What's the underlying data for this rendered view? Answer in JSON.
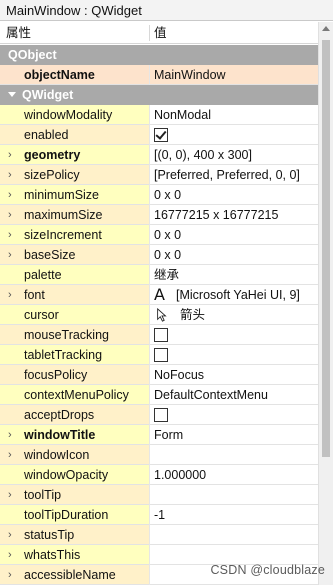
{
  "window": {
    "title": "MainWindow : QWidget"
  },
  "header": {
    "property": "属性",
    "value": "值"
  },
  "rows": [
    {
      "kind": "group",
      "name": "QObject"
    },
    {
      "kind": "prop",
      "name": "objectName",
      "value": "MainWindow",
      "bold": true
    },
    {
      "kind": "group",
      "name": "QWidget",
      "expanded": true
    },
    {
      "kind": "prop",
      "name": "windowModality",
      "value": "NonModal"
    },
    {
      "kind": "prop",
      "name": "enabled",
      "value": "checked"
    },
    {
      "kind": "prop",
      "name": "geometry",
      "value": "[(0, 0), 400 x 300]",
      "bold": true,
      "expandable": true
    },
    {
      "kind": "prop",
      "name": "sizePolicy",
      "value": "[Preferred, Preferred, 0, 0]",
      "expandable": true
    },
    {
      "kind": "prop",
      "name": "minimumSize",
      "value": "0 x 0",
      "expandable": true
    },
    {
      "kind": "prop",
      "name": "maximumSize",
      "value": "16777215 x 16777215",
      "expandable": true
    },
    {
      "kind": "prop",
      "name": "sizeIncrement",
      "value": "0 x 0",
      "expandable": true
    },
    {
      "kind": "prop",
      "name": "baseSize",
      "value": "0 x 0",
      "expandable": true
    },
    {
      "kind": "prop",
      "name": "palette",
      "value": "继承"
    },
    {
      "kind": "prop",
      "name": "font",
      "value": "[Microsoft YaHei UI, 9]",
      "expandable": true,
      "icon": "font"
    },
    {
      "kind": "prop",
      "name": "cursor",
      "value": "箭头",
      "icon": "cursor"
    },
    {
      "kind": "prop",
      "name": "mouseTracking",
      "value": "unchecked"
    },
    {
      "kind": "prop",
      "name": "tabletTracking",
      "value": "unchecked"
    },
    {
      "kind": "prop",
      "name": "focusPolicy",
      "value": "NoFocus"
    },
    {
      "kind": "prop",
      "name": "contextMenuPolicy",
      "value": "DefaultContextMenu"
    },
    {
      "kind": "prop",
      "name": "acceptDrops",
      "value": "unchecked"
    },
    {
      "kind": "prop",
      "name": "windowTitle",
      "value": "Form",
      "bold": true,
      "expandable": true
    },
    {
      "kind": "prop",
      "name": "windowIcon",
      "value": "",
      "expandable": true
    },
    {
      "kind": "prop",
      "name": "windowOpacity",
      "value": "1.000000"
    },
    {
      "kind": "prop",
      "name": "toolTip",
      "value": "",
      "expandable": true
    },
    {
      "kind": "prop",
      "name": "toolTipDuration",
      "value": "-1"
    },
    {
      "kind": "prop",
      "name": "statusTip",
      "value": "",
      "expandable": true
    },
    {
      "kind": "prop",
      "name": "whatsThis",
      "value": "",
      "expandable": true
    },
    {
      "kind": "prop",
      "name": "accessibleName",
      "value": "",
      "expandable": true
    }
  ],
  "watermark": "CSDN @cloudblaze",
  "colors": {
    "group_bg": "#a9a9a9",
    "prop_yellow": "#ffffbf",
    "prop_peach": "#fff1c9",
    "selected": "#fde3cc"
  }
}
